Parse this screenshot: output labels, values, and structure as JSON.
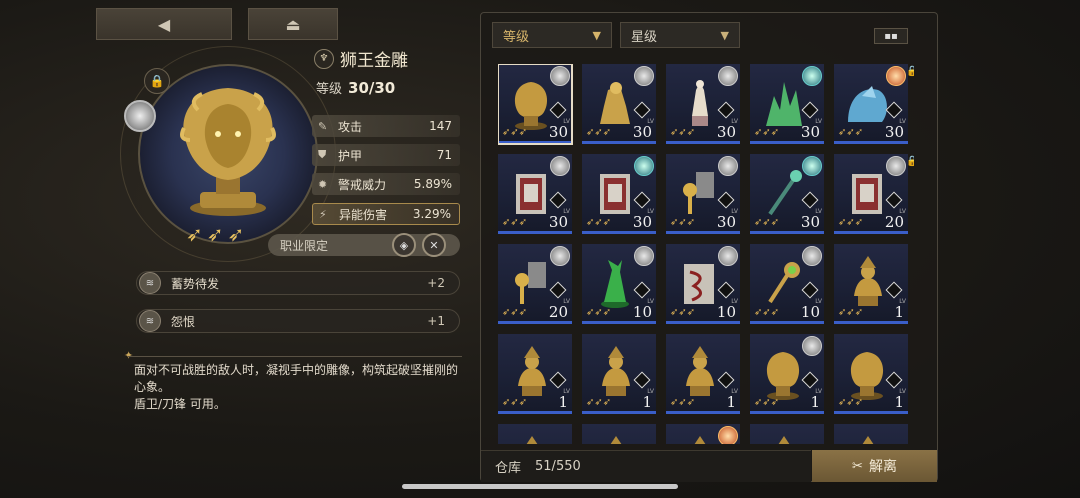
{
  "nav": {
    "back_icon": "◀",
    "home_icon": "⏏"
  },
  "item": {
    "name": "狮王金雕",
    "level_label": "等级",
    "level_value": "30/30",
    "stars": "➶➶➶",
    "stats": [
      {
        "icon": "✎",
        "label": "攻击",
        "value": "147"
      },
      {
        "icon": "⛊",
        "label": "护甲",
        "value": "71"
      },
      {
        "icon": "✹",
        "label": "警戒威力",
        "value": "5.89%"
      },
      {
        "icon": "⚡",
        "label": "异能伤害",
        "value": "3.29%"
      }
    ],
    "job_label": "职业限定",
    "skills": [
      {
        "label": "蓄势待发",
        "value": "+2"
      },
      {
        "label": "怨恨",
        "value": "+1"
      }
    ],
    "description_1": "面对不可战胜的敌人时，凝视手中的雕像，构筑起破坚摧刚的心象。",
    "description_2": "盾卫/刀锋 可用。"
  },
  "filters": {
    "level": "等级",
    "star": "星级"
  },
  "inventory": {
    "cells": [
      {
        "type": "lion",
        "num": "30",
        "badge": "grey",
        "sel": true
      },
      {
        "type": "gold-rider",
        "num": "30",
        "badge": "grey"
      },
      {
        "type": "white-statue",
        "num": "30",
        "badge": "grey"
      },
      {
        "type": "crystal",
        "num": "30",
        "badge": "teal"
      },
      {
        "type": "blue-lion",
        "num": "30",
        "badge": "orange",
        "lock": true
      },
      {
        "type": "book",
        "num": "30",
        "badge": "grey"
      },
      {
        "type": "book",
        "num": "30",
        "badge": "teal"
      },
      {
        "type": "key",
        "num": "30",
        "badge": "grey"
      },
      {
        "type": "scepter",
        "num": "30",
        "badge": "teal"
      },
      {
        "type": "book",
        "num": "20",
        "badge": "grey",
        "lock": true
      },
      {
        "type": "key",
        "num": "20",
        "badge": "grey"
      },
      {
        "type": "green-statue",
        "num": "10",
        "badge": "grey"
      },
      {
        "type": "red-book",
        "num": "10",
        "badge": "grey"
      },
      {
        "type": "green-key",
        "num": "10",
        "badge": "grey"
      },
      {
        "type": "bust",
        "num": "1",
        "badge": "none"
      },
      {
        "type": "bust",
        "num": "1",
        "badge": "none"
      },
      {
        "type": "bust",
        "num": "1",
        "badge": "none"
      },
      {
        "type": "bust",
        "num": "1",
        "badge": "none"
      },
      {
        "type": "lion",
        "num": "1",
        "badge": "grey"
      },
      {
        "type": "lion",
        "num": "1",
        "badge": "none"
      },
      {
        "type": "bust",
        "num": "",
        "badge": "none"
      },
      {
        "type": "bust",
        "num": "",
        "badge": "none"
      },
      {
        "type": "bust",
        "num": "",
        "badge": "orange"
      },
      {
        "type": "bust",
        "num": "",
        "badge": "none"
      },
      {
        "type": "bust",
        "num": "",
        "badge": "none"
      }
    ]
  },
  "footer": {
    "warehouse_label": "仓库",
    "warehouse_count": "51/550",
    "dismantle_label": "解离",
    "dismantle_icon": "✂"
  },
  "colors": {
    "accent_gold": "#d6b46a",
    "rarity_blue": "#3a5ec8"
  }
}
